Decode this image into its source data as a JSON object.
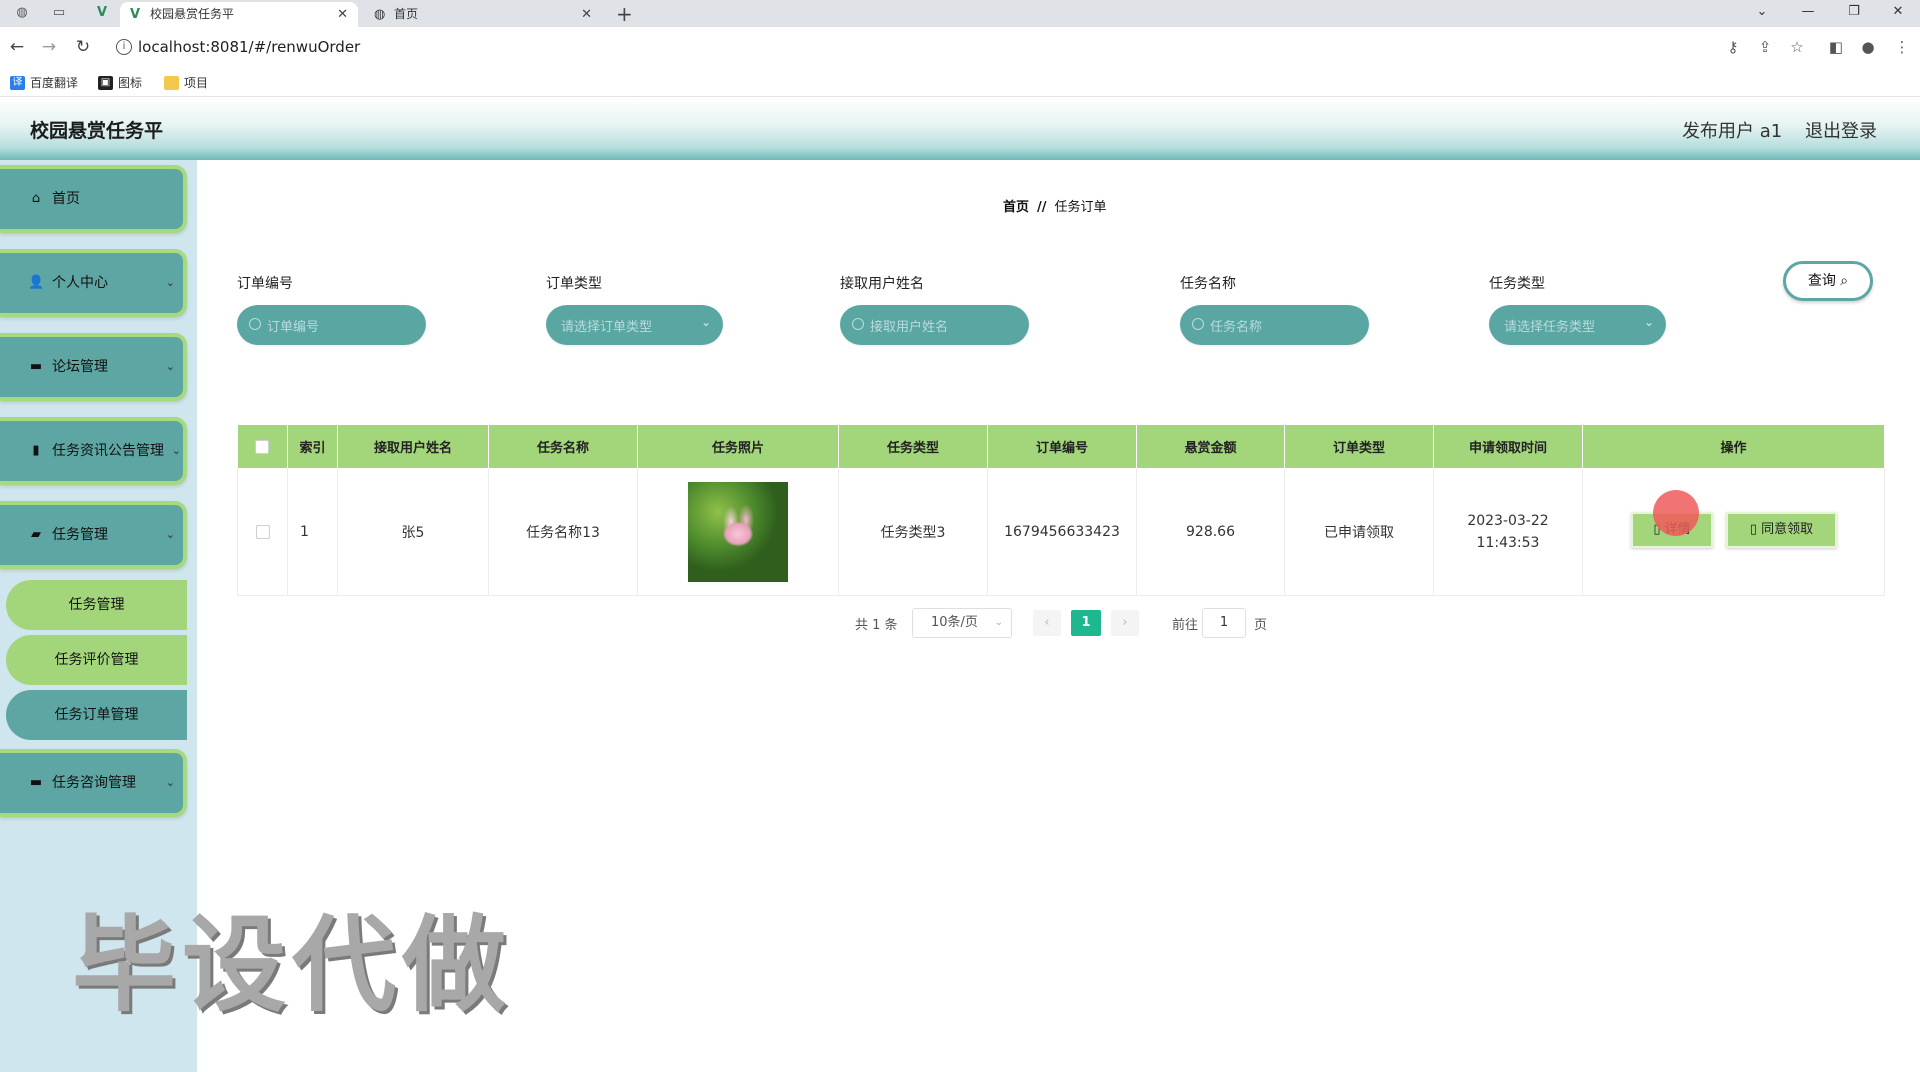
{
  "browser": {
    "tabs": [
      {
        "title": "校园悬赏任务平",
        "active": true
      },
      {
        "title": "首页",
        "active": false
      }
    ],
    "url": "localhost:8081/#/renwuOrder",
    "bookmarks": [
      "百度翻译",
      "图标",
      "项目"
    ]
  },
  "header": {
    "title": "校园悬赏任务平",
    "user_label": "发布用户 a1",
    "logout_label": "退出登录"
  },
  "sidebar": {
    "items": [
      {
        "label": "首页",
        "icon": "home-icon"
      },
      {
        "label": "个人中心",
        "icon": "user-icon"
      },
      {
        "label": "论坛管理",
        "icon": "monitor-icon"
      },
      {
        "label": "任务资讯公告管理",
        "icon": "bar-chart-icon"
      },
      {
        "label": "任务管理",
        "icon": "briefcase-icon"
      }
    ],
    "sub_items": [
      {
        "label": "任务管理"
      },
      {
        "label": "任务评价管理"
      },
      {
        "label": "任务订单管理",
        "active": true
      }
    ],
    "last_item": {
      "label": "任务咨询管理",
      "icon": "chat-icon"
    }
  },
  "breadcrumb": {
    "home": "首页",
    "separator": "//",
    "current": "任务订单"
  },
  "filters": [
    {
      "label": "订单编号",
      "placeholder": "订单编号",
      "type": "input"
    },
    {
      "label": "订单类型",
      "placeholder": "请选择订单类型",
      "type": "select"
    },
    {
      "label": "接取用户姓名",
      "placeholder": "接取用户姓名",
      "type": "input"
    },
    {
      "label": "任务名称",
      "placeholder": "任务名称",
      "type": "input"
    },
    {
      "label": "任务类型",
      "placeholder": "请选择任务类型",
      "type": "select"
    }
  ],
  "query_button": "查询",
  "table": {
    "columns": [
      "",
      "索引",
      "接取用户姓名",
      "任务名称",
      "任务照片",
      "任务类型",
      "订单编号",
      "悬赏金额",
      "订单类型",
      "申请领取时间",
      "操作"
    ],
    "rows": [
      {
        "index": "1",
        "user": "张5",
        "task_name": "任务名称13",
        "task_type": "任务类型3",
        "order_no": "1679456633423",
        "amount": "928.66",
        "order_type": "已申请领取",
        "apply_time": "2023-03-22 11:43:53",
        "actions": {
          "detail": "详情",
          "agree": "同意领取"
        }
      }
    ]
  },
  "pagination": {
    "total": "共 1 条",
    "page_size": "10条/页",
    "current": "1",
    "goto_label": "前往",
    "goto_value": "1",
    "unit": "页"
  },
  "watermark": "毕设代做",
  "colors": {
    "teal": "#5da6a3",
    "green": "#a3d67b",
    "accent": "#1fb88e"
  }
}
